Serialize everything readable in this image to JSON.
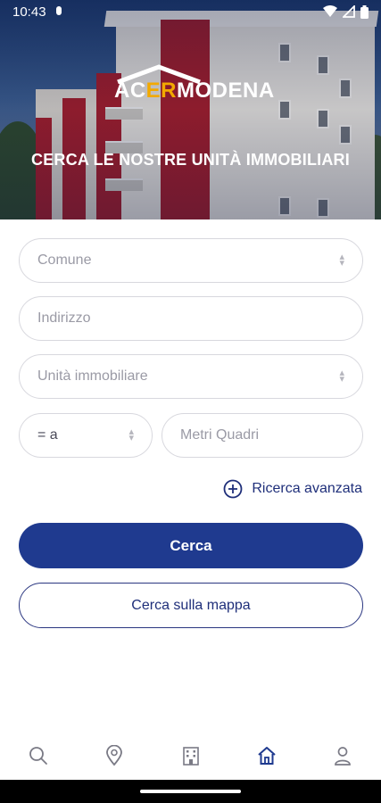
{
  "status_bar": {
    "time": "10:43",
    "icons": [
      "notification-dot-icon",
      "wifi-icon",
      "signal-icon",
      "battery-icon"
    ]
  },
  "hero": {
    "logo_text_1": "AC",
    "logo_text_2": "ER",
    "logo_text_3": "MODENA",
    "title": "CERCA LE NOSTRE UNITÀ IMMOBILIARI"
  },
  "form": {
    "comune_placeholder": "Comune",
    "indirizzo_placeholder": "Indirizzo",
    "unita_placeholder": "Unità immobiliare",
    "operator_value": "= a",
    "metri_placeholder": "Metri Quadri"
  },
  "advanced_search": {
    "label": "Ricerca avanzata"
  },
  "buttons": {
    "search_label": "Cerca",
    "map_search_label": "Cerca sulla mappa"
  },
  "bottom_nav": {
    "items": [
      {
        "icon": "search-icon",
        "active": false
      },
      {
        "icon": "location-pin-icon",
        "active": false
      },
      {
        "icon": "building-icon",
        "active": false
      },
      {
        "icon": "home-icon",
        "active": true
      },
      {
        "icon": "user-icon",
        "active": false
      }
    ]
  },
  "colors": {
    "primary": "#1f3a8f",
    "accent": "#f2a900",
    "text_dark_blue": "#1f2f7a",
    "placeholder": "#9a9aa5"
  }
}
